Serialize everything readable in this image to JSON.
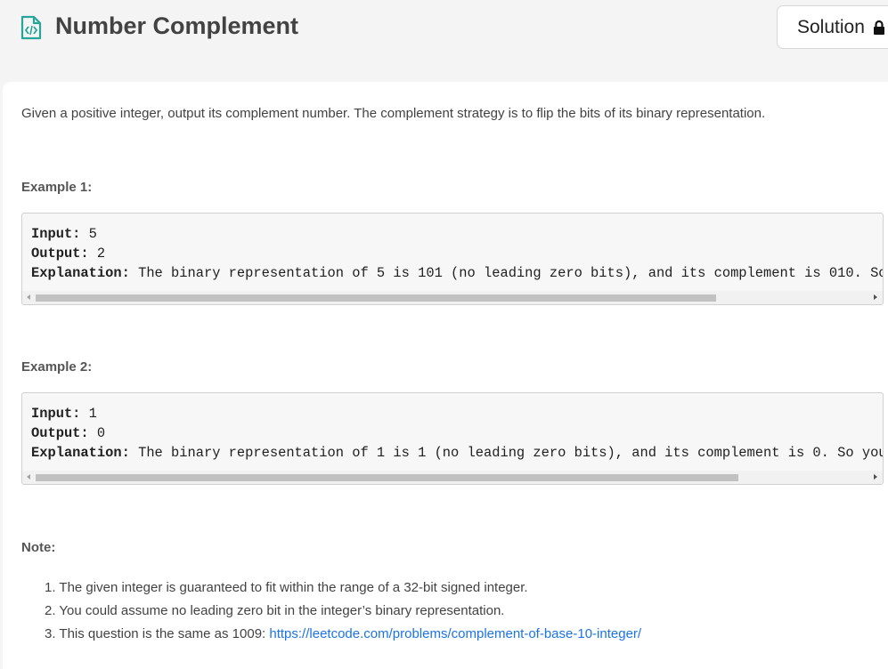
{
  "header": {
    "title": "Number Complement",
    "solution_label": "Solution",
    "icons": {
      "title": "code-file-icon",
      "solution": "lock-icon"
    }
  },
  "description": "Given a positive integer, output its complement number. The complement strategy is to flip the bits of its binary representation.",
  "examples": [
    {
      "label": "Example 1:",
      "input_key": "Input:",
      "input_val": " 5",
      "output_key": "Output:",
      "output_val": " 2",
      "expl_key": "Explanation:",
      "expl_val": " The binary representation of 5 is 101 (no leading zero bits), and its complement is 010. So"
    },
    {
      "label": "Example 2:",
      "input_key": "Input:",
      "input_val": " 1",
      "output_key": "Output:",
      "output_val": " 0",
      "expl_key": "Explanation:",
      "expl_val": " The binary representation of 1 is 1 (no leading zero bits), and its complement is 0. So you"
    }
  ],
  "note": {
    "label": "Note:",
    "items": [
      "1. The given integer is guaranteed to fit within the range of a 32-bit signed integer.",
      "2. You could assume no leading zero bit in the integer’s binary representation."
    ],
    "item3_prefix": "3. This question is the same as 1009: ",
    "item3_link": "https://leetcode.com/problems/complement-of-base-10-integer/"
  },
  "colors": {
    "accent_icon": "#26a69a",
    "link": "#1a73e8"
  }
}
